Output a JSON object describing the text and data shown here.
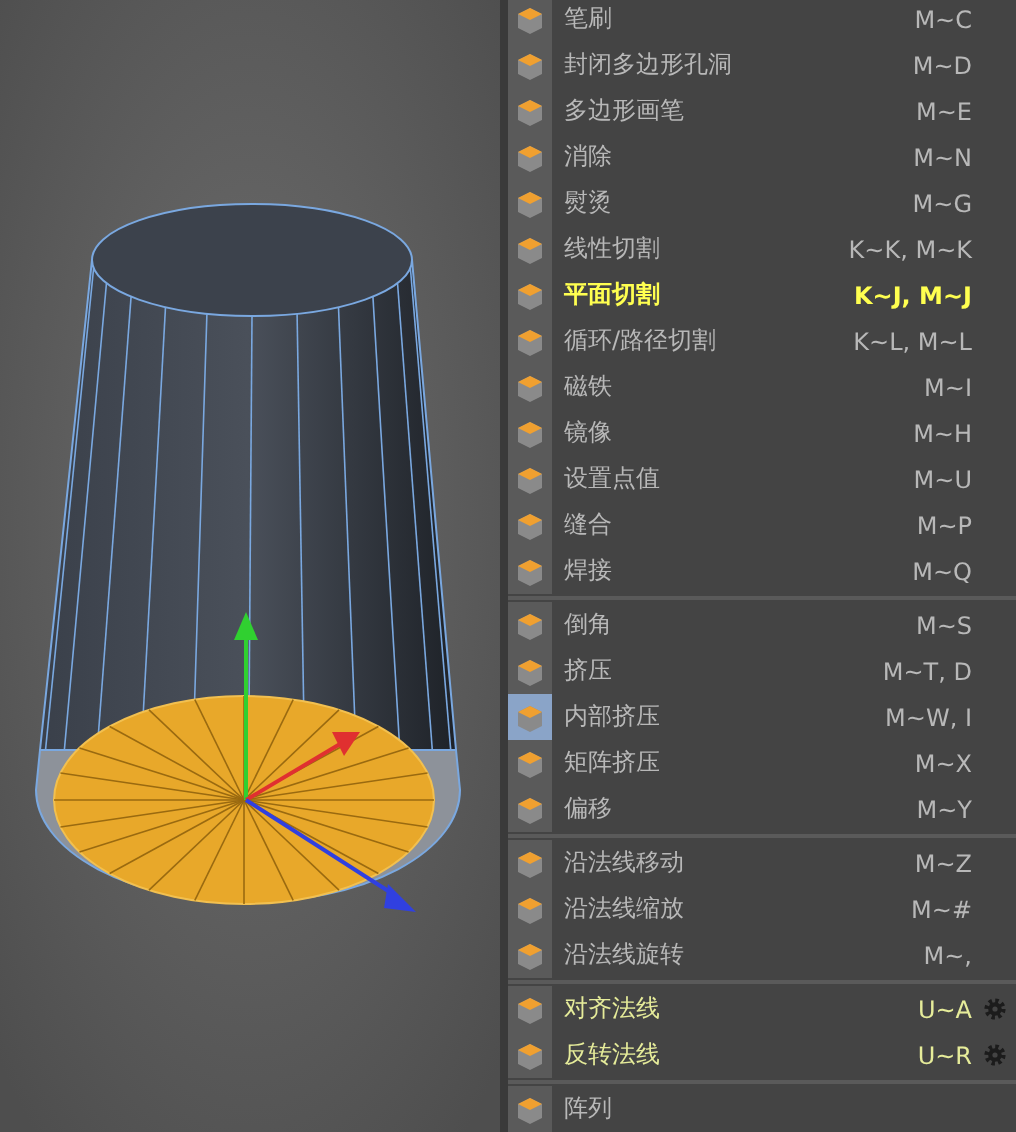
{
  "menu": {
    "groups": [
      {
        "items": [
          {
            "label": "笔刷",
            "shortcut": "M~C",
            "kind": "tool",
            "selected": false,
            "pressed": false
          },
          {
            "label": "封闭多边形孔洞",
            "shortcut": "M~D",
            "kind": "tool",
            "selected": false,
            "pressed": false
          },
          {
            "label": "多边形画笔",
            "shortcut": "M~E",
            "kind": "tool",
            "selected": false,
            "pressed": false
          },
          {
            "label": "消除",
            "shortcut": "M~N",
            "kind": "tool",
            "selected": false,
            "pressed": false
          },
          {
            "label": "熨烫",
            "shortcut": "M~G",
            "kind": "tool",
            "selected": false,
            "pressed": false
          },
          {
            "label": "线性切割",
            "shortcut": "K~K, M~K",
            "kind": "tool",
            "selected": false,
            "pressed": false
          },
          {
            "label": "平面切割",
            "shortcut": "K~J, M~J",
            "kind": "tool",
            "selected": true,
            "pressed": false
          },
          {
            "label": "循环/路径切割",
            "shortcut": "K~L, M~L",
            "kind": "tool",
            "selected": false,
            "pressed": false
          },
          {
            "label": "磁铁",
            "shortcut": "M~I",
            "kind": "tool",
            "selected": false,
            "pressed": false
          },
          {
            "label": "镜像",
            "shortcut": "M~H",
            "kind": "tool",
            "selected": false,
            "pressed": false
          },
          {
            "label": "设置点值",
            "shortcut": "M~U",
            "kind": "tool",
            "selected": false,
            "pressed": false
          },
          {
            "label": "缝合",
            "shortcut": "M~P",
            "kind": "tool",
            "selected": false,
            "pressed": false
          },
          {
            "label": "焊接",
            "shortcut": "M~Q",
            "kind": "tool",
            "selected": false,
            "pressed": false
          }
        ]
      },
      {
        "items": [
          {
            "label": "倒角",
            "shortcut": "M~S",
            "kind": "tool",
            "selected": false,
            "pressed": false
          },
          {
            "label": "挤压",
            "shortcut": "M~T, D",
            "kind": "tool",
            "selected": false,
            "pressed": false
          },
          {
            "label": "内部挤压",
            "shortcut": "M~W, I",
            "kind": "tool",
            "selected": false,
            "pressed": true
          },
          {
            "label": "矩阵挤压",
            "shortcut": "M~X",
            "kind": "tool",
            "selected": false,
            "pressed": false
          },
          {
            "label": "偏移",
            "shortcut": "M~Y",
            "kind": "tool",
            "selected": false,
            "pressed": false
          }
        ]
      },
      {
        "items": [
          {
            "label": "沿法线移动",
            "shortcut": "M~Z",
            "kind": "tool",
            "selected": false,
            "pressed": false
          },
          {
            "label": "沿法线缩放",
            "shortcut": "M~#",
            "kind": "tool",
            "selected": false,
            "pressed": false
          },
          {
            "label": "沿法线旋转",
            "shortcut": "M~,",
            "kind": "tool",
            "selected": false,
            "pressed": false
          }
        ]
      },
      {
        "items": [
          {
            "label": "对齐法线",
            "shortcut": "U~A",
            "kind": "command",
            "selected": false,
            "pressed": false
          },
          {
            "label": "反转法线",
            "shortcut": "U~R",
            "kind": "command",
            "selected": false,
            "pressed": false
          }
        ]
      },
      {
        "items": [
          {
            "label": "阵列",
            "kind": "tool",
            "selected": false,
            "pressed": false
          }
        ]
      }
    ]
  }
}
